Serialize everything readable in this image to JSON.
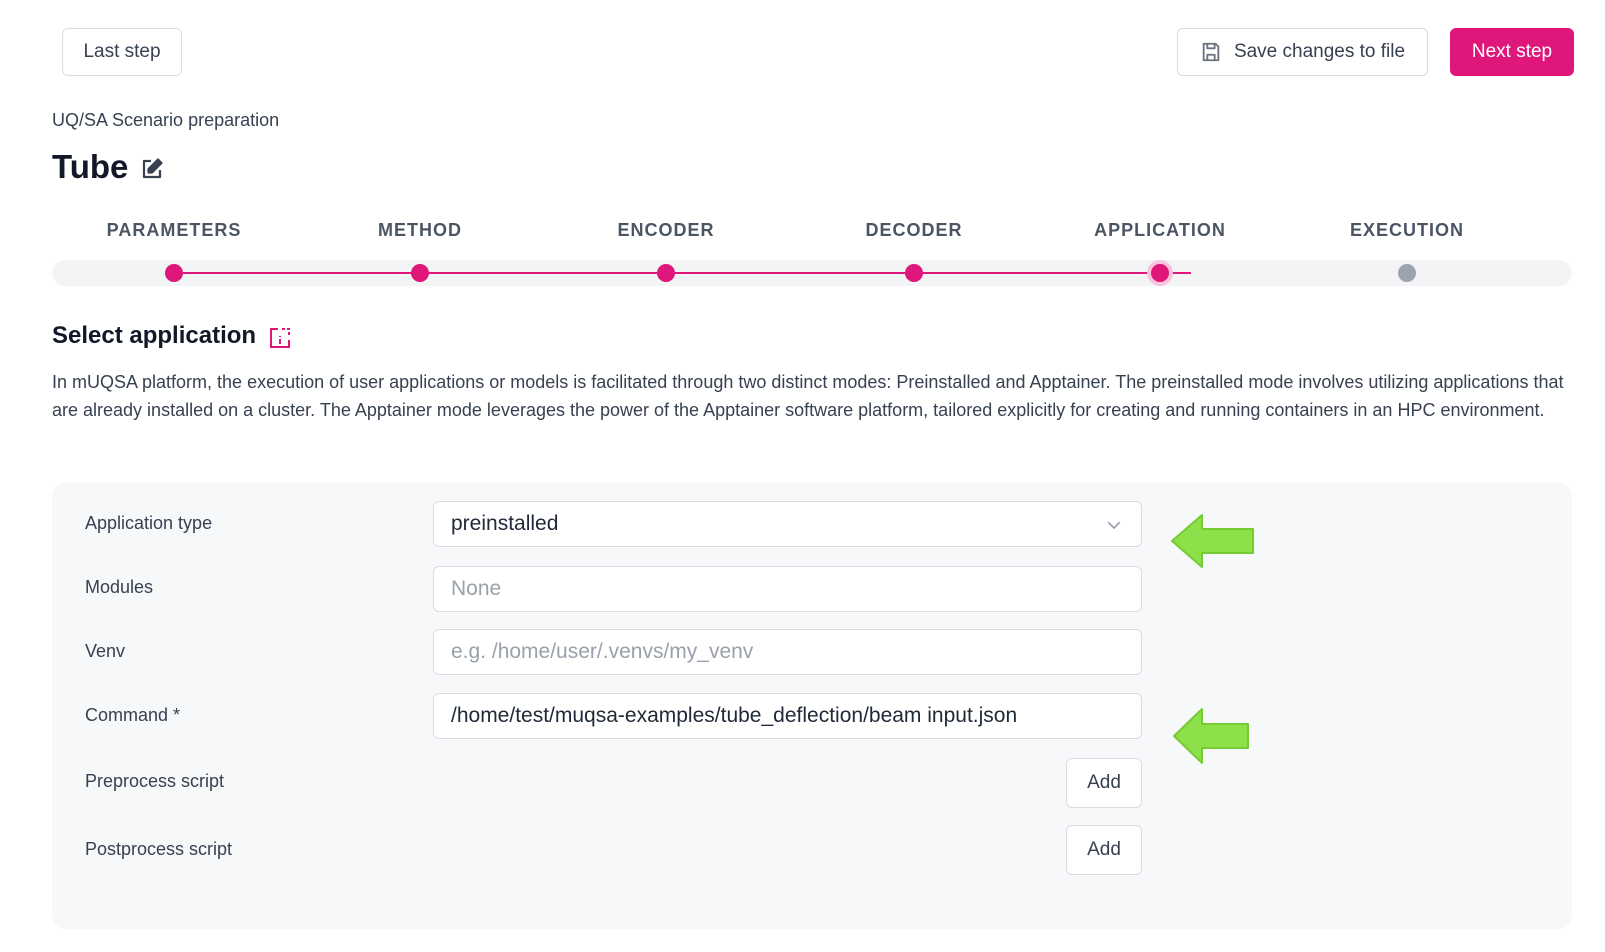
{
  "toolbar": {
    "last_step_label": "Last step",
    "save_label": "Save changes to file",
    "next_step_label": "Next step"
  },
  "header": {
    "subtitle": "UQ/SA Scenario preparation",
    "title": "Tube"
  },
  "stepper": {
    "steps": [
      {
        "label": "PARAMETERS",
        "state": "done"
      },
      {
        "label": "METHOD",
        "state": "done"
      },
      {
        "label": "ENCODER",
        "state": "done"
      },
      {
        "label": "DECODER",
        "state": "done"
      },
      {
        "label": "APPLICATION",
        "state": "current"
      },
      {
        "label": "EXECUTION",
        "state": "pending"
      }
    ]
  },
  "section": {
    "title": "Select application",
    "description": "In mUQSA platform, the execution of user applications or models is facilitated through two distinct modes: Preinstalled and Apptainer. The preinstalled mode involves utilizing applications that are already installed on a cluster. The Apptainer mode leverages the power of the Apptainer software platform, tailored explicitly for creating and running containers in an HPC environment."
  },
  "form": {
    "application_type": {
      "label": "Application type",
      "value": "preinstalled"
    },
    "modules": {
      "label": "Modules",
      "placeholder": "None"
    },
    "venv": {
      "label": "Venv",
      "placeholder": "e.g. /home/user/.venvs/my_venv"
    },
    "command": {
      "label": "Command *",
      "value": "/home/test/muqsa-examples/tube_deflection/beam input.json"
    },
    "preprocess": {
      "label": "Preprocess script",
      "button": "Add"
    },
    "postprocess": {
      "label": "Postprocess script",
      "button": "Add"
    }
  },
  "colors": {
    "accent": "#e0177b",
    "pending": "#9ca3af",
    "annotation_arrow": "#8de04a"
  }
}
